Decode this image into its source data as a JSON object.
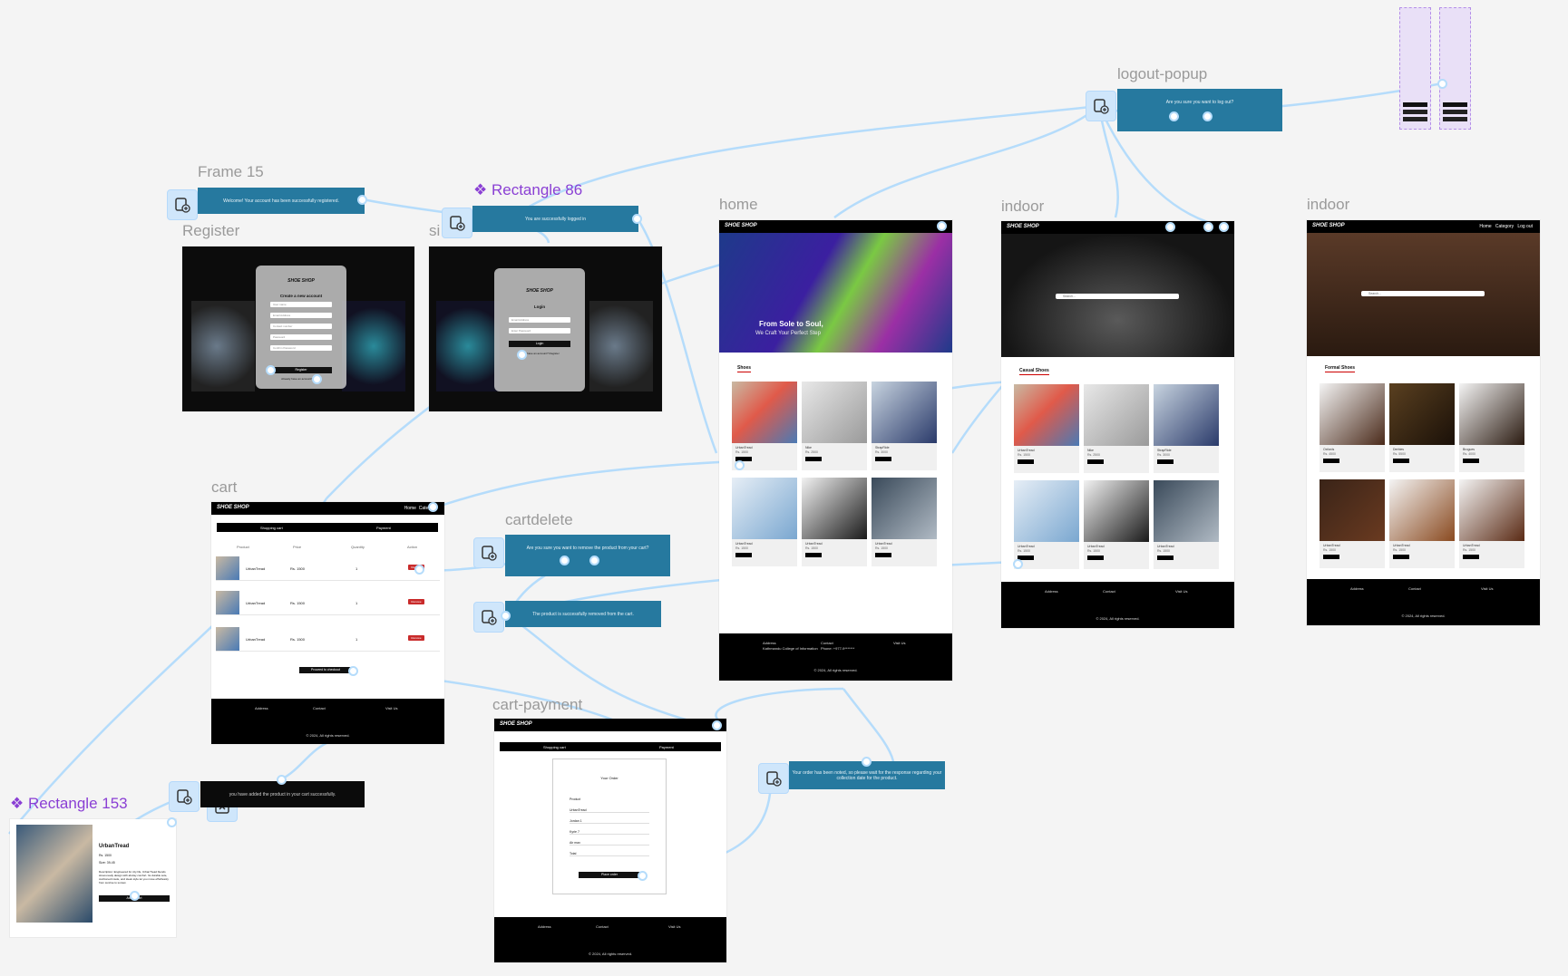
{
  "brand": {
    "logo_text": "SHOE SHOP"
  },
  "frames": {
    "frame15": {
      "label": "Frame 15",
      "message": "Welcome! Your account has been successfully registered."
    },
    "rect86": {
      "label": "Rectangle 86",
      "message": "You are successfully logged in"
    },
    "register": {
      "label": "Register",
      "title": "Create a new account",
      "fields": [
        "User name",
        "Email Address",
        "Contact number",
        "Password",
        "Confirm Password"
      ],
      "button": "Register",
      "footer_link": "Already have an account? Log in"
    },
    "signin": {
      "label": "si",
      "title": "Login",
      "fields": [
        "Email Address",
        "Enter Password"
      ],
      "button": "Login",
      "footer_link": "Don't have an account? Register"
    },
    "home": {
      "label": "home",
      "hero_line1": "From Sole to Soul,",
      "hero_line2": "We Craft Your Perfect Step",
      "section": "Shoes"
    },
    "indoor1": {
      "label": "indoor",
      "section": "Casual Shoes",
      "search": "Search..."
    },
    "indoor2": {
      "label": "indoor",
      "section": "Formal Shoes",
      "search": "Search...",
      "nav": [
        "Home",
        "Category",
        "Log out"
      ]
    },
    "logout": {
      "label": "logout-popup",
      "message": "Are you sure you want to log out?"
    },
    "cart": {
      "label": "cart",
      "tabs": [
        "Shopping cart",
        "Payment"
      ],
      "columns": [
        "Product",
        "Price",
        "Quantity",
        "Action"
      ],
      "rows": [
        {
          "name": "UrbanTread",
          "price": "Rs. 1500",
          "qty": "1",
          "action": "Remove"
        },
        {
          "name": "UrbanTread",
          "price": "Rs. 1500",
          "qty": "1",
          "action": "Remove"
        },
        {
          "name": "UrbanTread",
          "price": "Rs. 1500",
          "qty": "1",
          "action": "Remove"
        }
      ],
      "checkout": "Proceed to checkout",
      "nav": [
        "Home",
        "Category"
      ]
    },
    "cartdelete": {
      "label": "cartdelete",
      "message": "Are you sure you want to remove the product from your cart?",
      "removed": "The product is successfully removed from the cart."
    },
    "payment": {
      "label": "cart-payment",
      "tabs": [
        "Shopping cart",
        "Payment"
      ],
      "heading": "Your Order",
      "product_head": "Product",
      "items": [
        "UrbanTread",
        "Jordan 1",
        "Kyrie 7",
        "Air max",
        "Total"
      ],
      "button": "Place order"
    },
    "order_toast": {
      "message": "Your order has been noted, so please wait for the response regarding your collection date for the product."
    },
    "cart_toast": {
      "message": "you have added the product in your cart successfully."
    },
    "rect153": {
      "label": "Rectangle 153",
      "name": "UrbanTread",
      "price": "Rs. 1500",
      "size": "Size: 39-45",
      "desc": "Description: Engineered for city life, UrbanTread blends street-ready design with all-day comfort. Its durable sole, cushioned insole, and sleek style let you move effortlessly from sunrise to sunset.",
      "button": "Add to cart"
    }
  },
  "products": {
    "home": [
      {
        "name": "UrbanTread",
        "price": "Rs. 1500"
      },
      {
        "name": "Nike",
        "price": "Rs. 2500"
      },
      {
        "name": "StrapRide",
        "price": "Rs. 3000"
      },
      {
        "name": "UrbanTread",
        "price": "Rs. 1500"
      },
      {
        "name": "UrbanTread",
        "price": "Rs. 1500"
      },
      {
        "name": "UrbanTread",
        "price": "Rs. 1500"
      }
    ],
    "casual": [
      {
        "name": "UrbanTread",
        "price": "Rs. 1500"
      },
      {
        "name": "Nike",
        "price": "Rs. 2500"
      },
      {
        "name": "StrapRide",
        "price": "Rs. 3000"
      },
      {
        "name": "UrbanTread",
        "price": "Rs. 1500"
      },
      {
        "name": "UrbanTread",
        "price": "Rs. 1500"
      },
      {
        "name": "UrbanTread",
        "price": "Rs. 1500"
      }
    ],
    "formal": [
      {
        "name": "Oxfords",
        "price": "Rs. 4500"
      },
      {
        "name": "Derbies",
        "price": "Rs. 5500"
      },
      {
        "name": "Brogues",
        "price": "Rs. 4000"
      },
      {
        "name": "UrbanTread",
        "price": "Rs. 1500"
      },
      {
        "name": "UrbanTread",
        "price": "Rs. 1500"
      },
      {
        "name": "UrbanTread",
        "price": "Rs. 1500"
      }
    ]
  },
  "footer": {
    "address_head": "Address",
    "address": "Kathmandu College of Information",
    "city": "Pokhara, Nepal",
    "contact_head": "Contact",
    "phone": "Phone: +977-9*******",
    "email": "Email: admin@shop.com",
    "visit_head": "Visit Us",
    "copyright": "© 2024, All rights reserved."
  },
  "colors": {
    "toast": "#26799f",
    "canvas": "#f4f4f4",
    "wire": "#b5dcfb",
    "component": "#8a3fd4"
  }
}
